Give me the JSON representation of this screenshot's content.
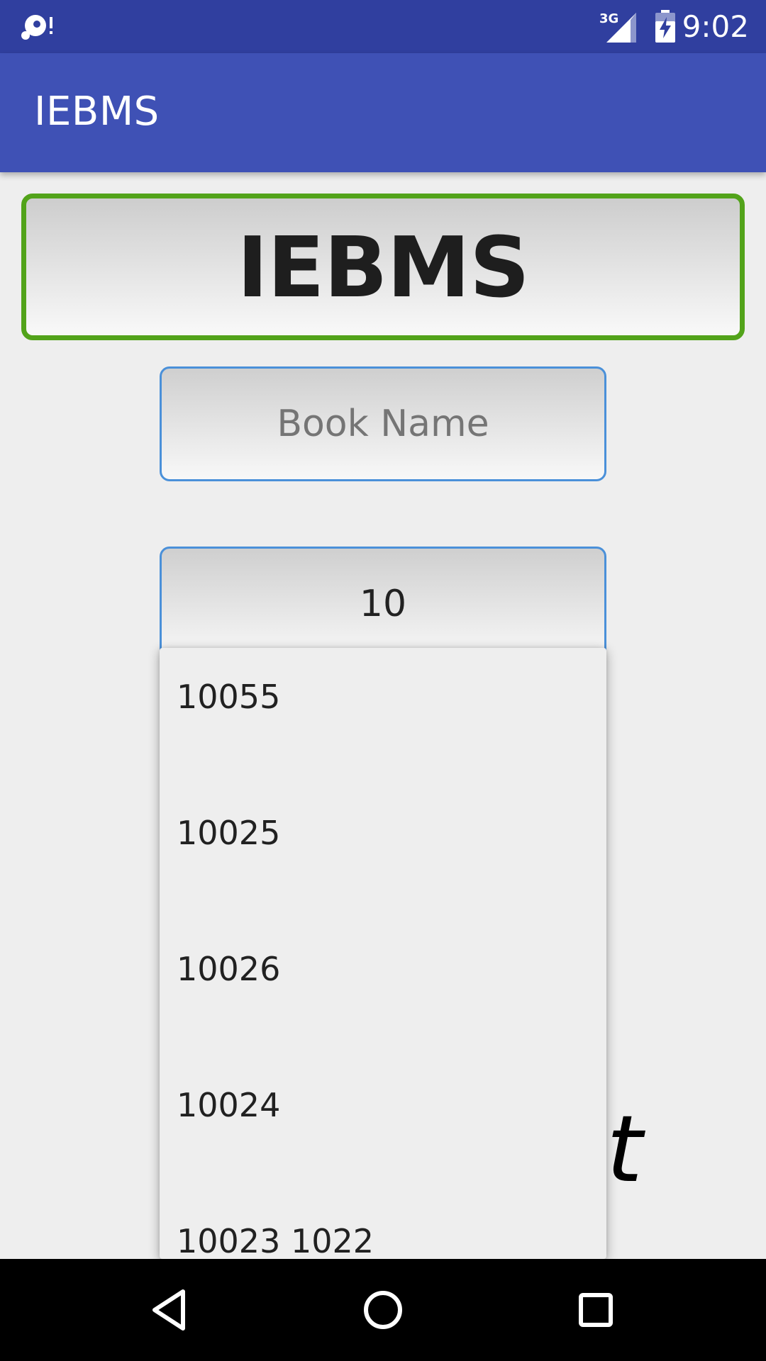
{
  "status_bar": {
    "time": "9:02",
    "network_label": "3G",
    "icons": [
      "media-notification-icon",
      "signal-3g-icon",
      "battery-charging-icon"
    ]
  },
  "app_bar": {
    "title": "IEBMS"
  },
  "header": {
    "title": "IEBMS",
    "border_color": "#52a31a"
  },
  "form": {
    "book_name_placeholder": "Book Name",
    "book_id_value": "10"
  },
  "background_text": "t",
  "dropdown": {
    "items": [
      "10055",
      "10025",
      "10026",
      "10024",
      "10023 1022"
    ]
  },
  "nav_bar": {
    "icons": [
      "back-icon",
      "home-icon",
      "recents-icon"
    ]
  },
  "colors": {
    "status_bar": "#303f9f",
    "app_bar": "#3f51b5",
    "field_border": "#4a90d9"
  }
}
